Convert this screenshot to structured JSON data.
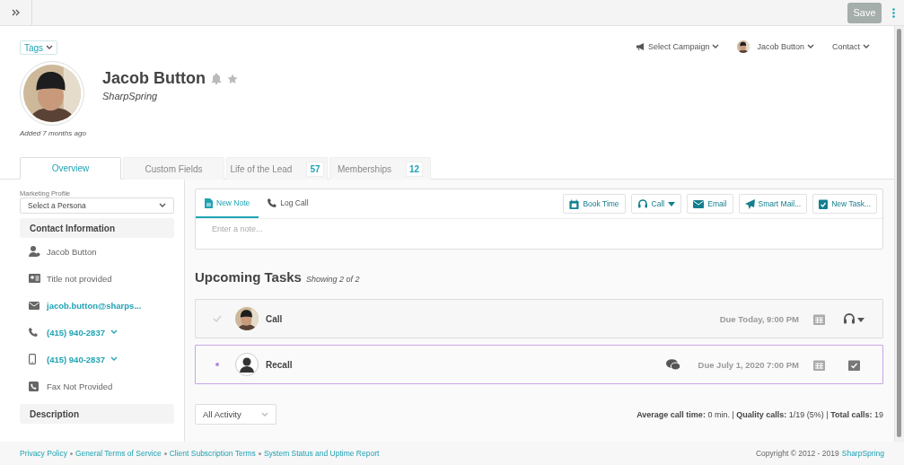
{
  "topbar": {
    "save": "Save"
  },
  "header": {
    "tags": "Tags",
    "name": "Jacob Button",
    "company": "SharpSpring",
    "added": "Added 7 months ago",
    "menus": [
      {
        "label": "Select Campaign",
        "kind": "campaign"
      },
      {
        "label": "Jacob Button",
        "kind": "user"
      },
      {
        "label": "Contact",
        "kind": "plain"
      }
    ]
  },
  "tabs": [
    {
      "label": "Overview",
      "selected": true
    },
    {
      "label": "Custom Fields",
      "selected": false
    },
    {
      "label": "Life of the Lead",
      "count": "57",
      "selected": false
    },
    {
      "label": "Memberships",
      "count": "12",
      "selected": false
    }
  ],
  "sidebar": {
    "profile_label": "Marketing Profile",
    "persona": "Select a Persona",
    "contact_heading": "Contact Information",
    "contact_items": [
      {
        "kind": "person",
        "text": "Jacob Button",
        "link": false,
        "dropdown": false
      },
      {
        "kind": "title",
        "text": "Title not provided",
        "link": false,
        "dropdown": false
      },
      {
        "kind": "email",
        "text": "jacob.button@sharps...",
        "link": true,
        "dropdown": false
      },
      {
        "kind": "phone",
        "text": "(415) 940-2837",
        "link": true,
        "dropdown": true
      },
      {
        "kind": "mobile",
        "text": "(415) 940-2837",
        "link": true,
        "dropdown": true
      },
      {
        "kind": "fax",
        "text": "Fax Not Provided",
        "link": false,
        "dropdown": false
      }
    ],
    "description_heading": "Description"
  },
  "composer": {
    "tabs": [
      {
        "label": "New Note",
        "kind": "note",
        "selected": true
      },
      {
        "label": "Log Call",
        "kind": "call",
        "selected": false
      }
    ],
    "actions": [
      {
        "label": "Book Time",
        "kind": "calendar",
        "dropdown": false
      },
      {
        "label": "Call",
        "kind": "headset",
        "dropdown": true
      },
      {
        "label": "Email",
        "kind": "email",
        "dropdown": false
      },
      {
        "label": "Smart Mail...",
        "kind": "send",
        "dropdown": false
      },
      {
        "label": "New Task...",
        "kind": "task",
        "dropdown": false
      }
    ],
    "placeholder": "Enter a note..."
  },
  "tasks_heading": "Upcoming Tasks",
  "tasks_count": "Showing 2 of 2",
  "tasks": [
    {
      "title": "Call",
      "kind": "call",
      "has_photo": true,
      "checked": true,
      "selected": false,
      "due": "Due Today, 9:00 PM"
    },
    {
      "title": "Recall",
      "kind": "meeting",
      "has_photo": false,
      "checked": false,
      "selected": true,
      "due": "Due July 1, 2020 7:00 PM"
    }
  ],
  "filter": "All Activity",
  "stats": "**Average call time:** 0 min. | **Quality calls:** 1/19 (5%) | **Total calls:** 19",
  "footer": {
    "links": [
      "Privacy Policy",
      "General Terms of Service",
      "Client Subscription Terms",
      "System Status and Uptime Report"
    ],
    "copyright": "Copyright © 2012 - 2019",
    "brand": "SharpSpring"
  }
}
